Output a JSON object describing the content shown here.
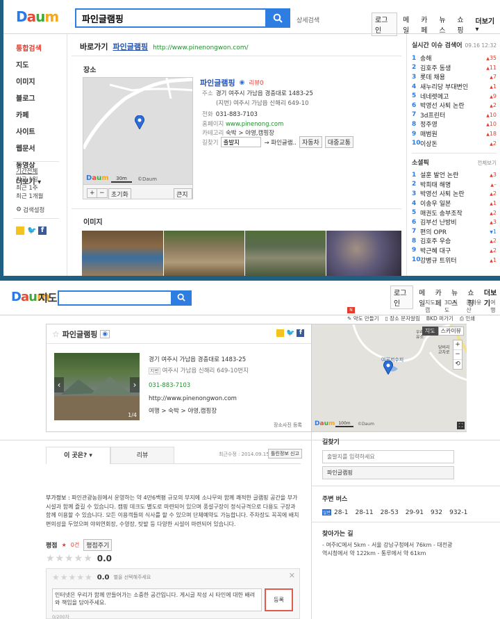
{
  "top": {
    "search_query": "파인글램핑",
    "detail_search": "상세검색",
    "nav": [
      "로그인",
      "메일",
      "카페",
      "뉴스",
      "쇼핑",
      "더보기 ▾"
    ],
    "left_nav": [
      "통합검색",
      "지도",
      "이미지",
      "블로그",
      "카페",
      "사이트",
      "웹문서",
      "동영상",
      "더보기 ▾"
    ],
    "period": {
      "title": "기간전체",
      "items": [
        "최근 1일",
        "최근 1주",
        "최근 1개월"
      ]
    },
    "search_settings": "검색설정",
    "shortcut": {
      "label": "바로가기",
      "name": "파인글램핑",
      "url": "http://www.pinenongwon.com/"
    },
    "place_title": "장소",
    "place": {
      "name": "파인글램핑",
      "review": "리뷰0",
      "addr_label": "주소",
      "address": "경기 여주시 가남읍 경충대로 1483-25",
      "jibun": "(지번) 여주시 가남읍 신해리 649-10",
      "phone_label": "전화",
      "phone": "031-883-7103",
      "home_label": "홈페이지",
      "homepage": "www.pinenong.com",
      "cat_label": "카테고리",
      "category": "숙박 > 야영,캠핑장",
      "route_label": "길찾기",
      "origin": "출발지",
      "dest": "→ 파인글램..",
      "car_btn": "자동차",
      "transit_btn": "대중교통"
    },
    "map_ctrl": {
      "plus": "+",
      "minus": "−",
      "reset": "초기화",
      "bigmap": "큰지도",
      "scale": "30m",
      "copy": "©Daum"
    },
    "image_title": "이미지",
    "issues": {
      "title": "실시간 이슈 검색어",
      "time": "09.16 12:32",
      "items": [
        {
          "n": "1",
          "t": "송해",
          "r": "35"
        },
        {
          "n": "2",
          "t": "김호주 동생",
          "r": "11"
        },
        {
          "n": "3",
          "t": "롯데 채용",
          "r": "7"
        },
        {
          "n": "4",
          "t": "새누리당 부대변인",
          "r": "1"
        },
        {
          "n": "5",
          "t": "네네렛메고",
          "r": "9"
        },
        {
          "n": "6",
          "t": "박영선 사퇴 논란",
          "r": "2"
        },
        {
          "n": "7",
          "t": "3d프린터",
          "r": "10"
        },
        {
          "n": "8",
          "t": "정주영",
          "r": "10"
        },
        {
          "n": "9",
          "t": "매범원",
          "r": "18"
        },
        {
          "n": "10",
          "t": "이상돈",
          "r": "2"
        }
      ]
    },
    "social": {
      "title": "소셜픽",
      "more": "전체보기",
      "items": [
        {
          "n": "1",
          "t": "설훈 발언 논란",
          "r": "3",
          "up": true
        },
        {
          "n": "2",
          "t": "박희태 해명",
          "r": "–",
          "up": true
        },
        {
          "n": "3",
          "t": "박영선 사퇴 논란",
          "r": "2",
          "up": true
        },
        {
          "n": "4",
          "t": "이송우 일본",
          "r": "1",
          "up": true
        },
        {
          "n": "5",
          "t": "매권도 송부조작",
          "r": "2",
          "up": true
        },
        {
          "n": "6",
          "t": "김부선 난방비",
          "r": "3",
          "up": true
        },
        {
          "n": "7",
          "t": "편의 OPR",
          "r": "1",
          "up": false
        },
        {
          "n": "8",
          "t": "김호주 우승",
          "r": "2",
          "up": true
        },
        {
          "n": "9",
          "t": "박근혜 대구",
          "r": "2",
          "up": true
        },
        {
          "n": "10",
          "t": "강병규 트위터",
          "r": "1",
          "up": true
        }
      ]
    }
  },
  "bottom": {
    "title": "지도",
    "nav": [
      "로그인",
      "메일",
      "카페",
      "뉴스",
      "쇼핑",
      "더보기"
    ],
    "sub_nav": [
      "지도캡",
      "3D지도",
      "문화유산",
      "여행"
    ],
    "tools": [
      "약도 만들기",
      "장소 문자알림",
      "인쇄",
      "인쇄"
    ],
    "tool_labels": {
      "sketch": "약도 만들기",
      "sms": "장소 문자알림",
      "sketch2": "BKD 퍼가기",
      "print": "인쇄"
    },
    "place": {
      "name": "파인글램핑",
      "address": "경기 여주시 가남읍 경충대로 1483-25",
      "jibun_tag": "지번",
      "jibun": "여주시 가남읍 신해리 649-10번지",
      "phone": "031-883-7103",
      "url": "http://www.pinenongwon.com",
      "category": "여행 > 숙박 > 야영,캠핑장",
      "photo_count": "1/4",
      "photo_link": "장소사진 등록"
    },
    "map": {
      "tab_map": "지도",
      "tab_sky": "스카이뷰",
      "label1": "여울저수지",
      "label2": "우리남 주유소",
      "label3": "당비리 교차로",
      "scale": "100m",
      "copy": "©Daum"
    },
    "tabs": {
      "about": "이 곳은? ▾",
      "review": "리뷰"
    },
    "updated": "최근수정 : 2014.09.15",
    "report": "틀린정보 신고",
    "extra_label": "부가정보 :",
    "extra": "파인관광농원에서 운영하는 약 4만6백평 규모의 부지에 소나무와 함께 쾌적한 글램핑 공간을 부가 시설과 함께 즐길 수 있습니다. 캠핑 데크도 별도로 마련되어 있으며 풍설구장이 정식규격으로 다용도 구장과 함께 이용할 수 있습니다. 모든 이용객들의 식사를 할 수 있으며 단체예약도 가능합니다. 주차장도 꼭꼭에 배치 편의성을 두었으며 야외연회장, 수영장, 탓밭 등 다양한 시설이 마련되어 있습니다.",
    "rating": {
      "label": "평점",
      "count": "0건",
      "write": "평점주기",
      "score": "0.0",
      "score2": "0.0",
      "hint": "별을 선택해주세요"
    },
    "comment": {
      "text": "인터넷은 우리가 함께 만들어가는 소중한 공간입니다. 게시글 작성 시 타인에 대한 배려와 책임을 담아주세요.",
      "count": "0/200자",
      "submit": "등록"
    },
    "route": {
      "title": "길찾기",
      "placeholder": "출발지를 입력하세요",
      "dest": "파인글램핑"
    },
    "bus": {
      "title": "주변 버스",
      "tag": "일반",
      "lines": [
        "28-1",
        "28-11",
        "28-53",
        "29-91",
        "932",
        "932-1"
      ]
    },
    "directions": {
      "title": "찾아가는 길",
      "text": "- 여주IC에서 5km - 서울 강남구청에서 76km - 대전광역시청에서 약 122km - 통루에서 약 61km"
    }
  }
}
